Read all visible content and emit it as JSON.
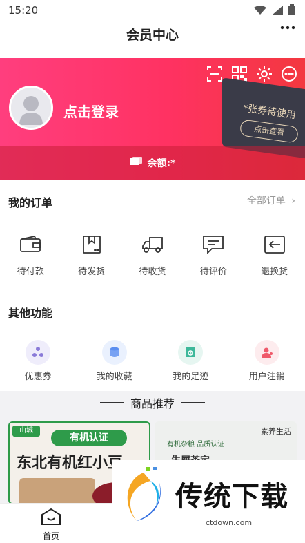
{
  "status_bar": {
    "time": "15:20",
    "icons": [
      "wifi-icon",
      "signal-icon",
      "battery-icon"
    ]
  },
  "header": {
    "title": "会员中心",
    "more_icon": "more-icon"
  },
  "banner": {
    "top_icons": [
      "scan-icon",
      "qrcode-icon",
      "settings-icon",
      "message-icon"
    ],
    "login_text": "点击登录",
    "coupon_text": "*张券待使用",
    "coupon_button": "点击查看",
    "balance_label": "余额:*",
    "colors": {
      "gradient_start": "#ff3e7e",
      "gradient_end": "#f3383f",
      "coupon_bg": "#3a3b48",
      "coupon_text": "#e8d6b8"
    }
  },
  "orders": {
    "title": "我的订单",
    "all_orders": "全部订单",
    "items": [
      {
        "label": "待付款",
        "icon": "wallet-icon"
      },
      {
        "label": "待发货",
        "icon": "box-icon"
      },
      {
        "label": "待收货",
        "icon": "truck-icon"
      },
      {
        "label": "待评价",
        "icon": "comment-icon"
      },
      {
        "label": "退换货",
        "icon": "return-icon"
      }
    ]
  },
  "functions": {
    "title": "其他功能",
    "items": [
      {
        "label": "优惠券",
        "icon": "coupon-icon",
        "color": "#8a7ad8"
      },
      {
        "label": "我的收藏",
        "icon": "collect-icon",
        "color": "#5b8ef0"
      },
      {
        "label": "我的足迹",
        "icon": "footprint-icon",
        "color": "#3db89a"
      },
      {
        "label": "用户注销",
        "icon": "user-cancel-icon",
        "color": "#ef5a6b"
      }
    ]
  },
  "recommend": {
    "title": "商品推荐",
    "products": [
      {
        "title": "东北有机红小豆",
        "badge": "有机认证",
        "brand": "山城"
      },
      {
        "title": "生犀茶定",
        "badge": "有机杂粮 品质认证",
        "brand": "素养生活"
      }
    ]
  },
  "bottom_nav": {
    "home_label": "首页"
  },
  "watermark": {
    "title": "传统下载",
    "url": "ctdown.com"
  }
}
